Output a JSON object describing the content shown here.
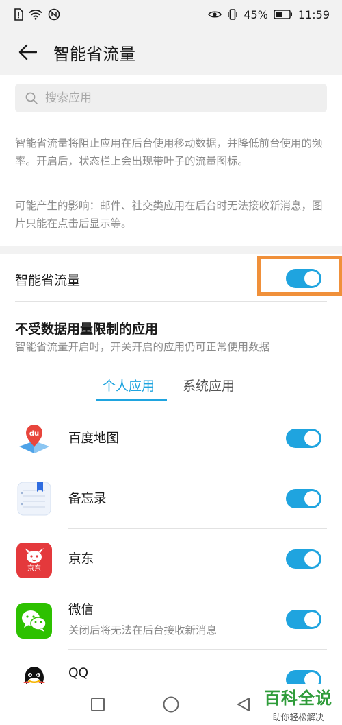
{
  "status_bar": {
    "battery": "45%",
    "time": "11:59"
  },
  "header": {
    "title": "智能省流量"
  },
  "search": {
    "placeholder": "搜索应用"
  },
  "description": {
    "paragraph1": "智能省流量将阻止应用在后台使用移动数据，并降低前台使用的频率。开启后，状态栏上会出现带叶子的流量图标。",
    "paragraph2": "可能产生的影响：邮件、社交类应用在后台时无法接收新消息，图片只能在点击后显示等。"
  },
  "main_switch": {
    "label": "智能省流量",
    "enabled": true
  },
  "unrestricted": {
    "title": "不受数据用量限制的应用",
    "subtitle": "智能省流量开启时，开关开启的应用仍可正常使用数据"
  },
  "tabs": [
    {
      "label": "个人应用",
      "active": true
    },
    {
      "label": "系统应用",
      "active": false
    }
  ],
  "apps": [
    {
      "name": "百度地图",
      "note": "",
      "enabled": true,
      "icon": "baidu-map-icon"
    },
    {
      "name": "备忘录",
      "note": "",
      "enabled": true,
      "icon": "notepad-icon"
    },
    {
      "name": "京东",
      "note": "",
      "enabled": true,
      "icon": "jd-icon",
      "icon_text": "京东"
    },
    {
      "name": "微信",
      "note": "关闭后将无法在后台接收新消息",
      "enabled": true,
      "icon": "wechat-icon"
    },
    {
      "name": "QQ",
      "note": "",
      "enabled": true,
      "icon": "qq-icon"
    }
  ],
  "watermark": {
    "title": "百科全说",
    "subtitle": "助你轻松解决"
  },
  "colors": {
    "accent": "#1fa4df",
    "highlight": "#f0903a",
    "watermark": "#2f9c3a"
  }
}
